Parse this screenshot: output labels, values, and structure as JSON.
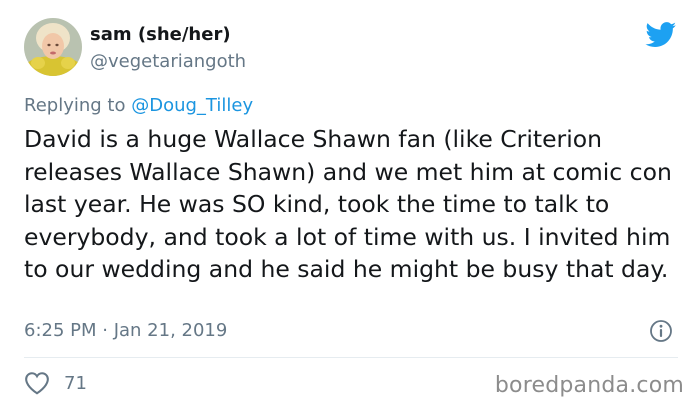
{
  "user": {
    "display_name": "sam (she/her)",
    "handle": "@vegetariangoth"
  },
  "reply": {
    "prefix": "Replying to",
    "mention": "@Doug_Tilley"
  },
  "tweet": {
    "text": "David is a huge Wallace Shawn fan (like Criterion releases Wallace Shawn) and we met him at comic con last year. He was SO kind, took the time to talk to everybody, and took a lot of time with us. I invited him to our wedding and he said he might be busy that day.",
    "timestamp": "6:25 PM · Jan 21, 2019"
  },
  "stats": {
    "likes": "71"
  },
  "watermark": "boredpanda.com",
  "colors": {
    "twitter_blue": "#1da1f2",
    "muted_text": "#657786",
    "link": "#1b95e0"
  },
  "icons": {
    "logo": "twitter-bird-icon",
    "info": "info-icon",
    "like": "heart-icon"
  }
}
